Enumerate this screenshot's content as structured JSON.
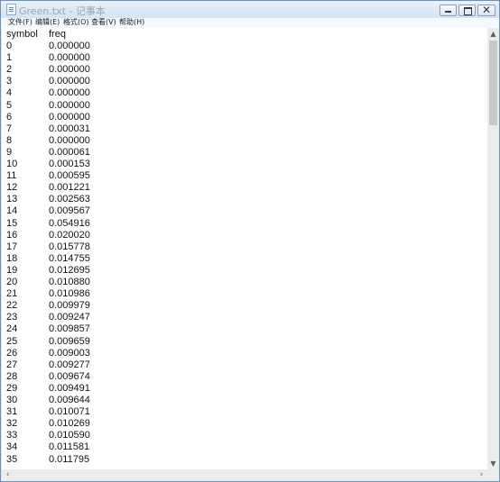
{
  "window": {
    "title": "Green.txt - 记事本",
    "minimize_icon": "minimize-icon",
    "maximize_icon": "maximize-icon",
    "close_label": "✕"
  },
  "menu": {
    "items": [
      {
        "label": "文件(F)"
      },
      {
        "label": "编辑(E)"
      },
      {
        "label": "格式(O)"
      },
      {
        "label": "查看(V)"
      },
      {
        "label": "帮助(H)"
      }
    ]
  },
  "document": {
    "header": {
      "symbol": "symbol",
      "freq": "freq"
    },
    "rows": [
      {
        "symbol": "0",
        "freq": "0.000000"
      },
      {
        "symbol": "1",
        "freq": "0.000000"
      },
      {
        "symbol": "2",
        "freq": "0.000000"
      },
      {
        "symbol": "3",
        "freq": "0.000000"
      },
      {
        "symbol": "4",
        "freq": "0.000000"
      },
      {
        "symbol": "5",
        "freq": "0.000000"
      },
      {
        "symbol": "6",
        "freq": "0.000000"
      },
      {
        "symbol": "7",
        "freq": "0.000031"
      },
      {
        "symbol": "8",
        "freq": "0.000000"
      },
      {
        "symbol": "9",
        "freq": "0.000061"
      },
      {
        "symbol": "10",
        "freq": "0.000153"
      },
      {
        "symbol": "11",
        "freq": "0.000595"
      },
      {
        "symbol": "12",
        "freq": "0.001221"
      },
      {
        "symbol": "13",
        "freq": "0.002563"
      },
      {
        "symbol": "14",
        "freq": "0.009567"
      },
      {
        "symbol": "15",
        "freq": "0.054916"
      },
      {
        "symbol": "16",
        "freq": "0.020020"
      },
      {
        "symbol": "17",
        "freq": "0.015778"
      },
      {
        "symbol": "18",
        "freq": "0.014755"
      },
      {
        "symbol": "19",
        "freq": "0.012695"
      },
      {
        "symbol": "20",
        "freq": "0.010880"
      },
      {
        "symbol": "21",
        "freq": "0.010986"
      },
      {
        "symbol": "22",
        "freq": "0.009979"
      },
      {
        "symbol": "23",
        "freq": "0.009247"
      },
      {
        "symbol": "24",
        "freq": "0.009857"
      },
      {
        "symbol": "25",
        "freq": "0.009659"
      },
      {
        "symbol": "26",
        "freq": "0.009003"
      },
      {
        "symbol": "27",
        "freq": "0.009277"
      },
      {
        "symbol": "28",
        "freq": "0.009674"
      },
      {
        "symbol": "29",
        "freq": "0.009491"
      },
      {
        "symbol": "30",
        "freq": "0.009644"
      },
      {
        "symbol": "31",
        "freq": "0.010071"
      },
      {
        "symbol": "32",
        "freq": "0.010269"
      },
      {
        "symbol": "33",
        "freq": "0.010590"
      },
      {
        "symbol": "34",
        "freq": "0.011581"
      },
      {
        "symbol": "35",
        "freq": "0.011795"
      }
    ]
  },
  "scrollbars": {
    "vertical_up_icon": "scroll-up-arrow-icon",
    "vertical_down_icon": "scroll-down-arrow-icon",
    "horizontal_left_icon": "scroll-left-arrow-icon",
    "horizontal_right_icon": "scroll-right-arrow-icon"
  }
}
